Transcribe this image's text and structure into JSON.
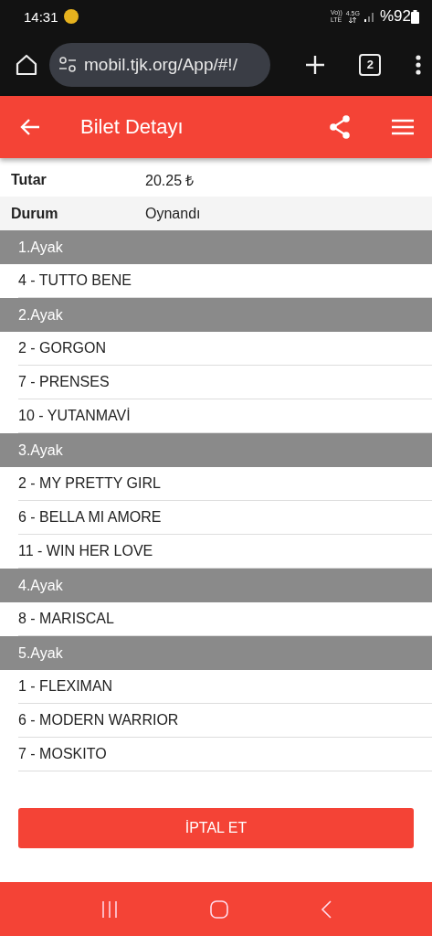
{
  "status_bar": {
    "time": "14:31",
    "network_top": "Vo))",
    "network_bottom": "LTE",
    "data_type": "4.5G",
    "battery": "%92"
  },
  "browser": {
    "url": "mobil.tjk.org/App/#!/",
    "tab_count": "2"
  },
  "app_bar": {
    "title": "Bilet Detayı"
  },
  "details": [
    {
      "label": "Tutar",
      "value": "20.25 ₺"
    },
    {
      "label": "Durum",
      "value": "Oynandı"
    }
  ],
  "legs": [
    {
      "title": "1.Ayak",
      "horses": [
        "4 - TUTTO BENE"
      ]
    },
    {
      "title": "2.Ayak",
      "horses": [
        "2 - GORGON",
        "7 - PRENSES",
        "10 - YUTANMAVİ"
      ]
    },
    {
      "title": "3.Ayak",
      "horses": [
        "2 - MY PRETTY GIRL",
        "6 - BELLA MI AMORE",
        "11 - WIN HER LOVE"
      ]
    },
    {
      "title": "4.Ayak",
      "horses": [
        "8 - MARISCAL"
      ]
    },
    {
      "title": "5.Ayak",
      "horses": [
        "1 - FLEXIMAN",
        "6 - MODERN WARRIOR",
        "7 - MOSKITO"
      ]
    }
  ],
  "cancel_button": "İPTAL ET"
}
